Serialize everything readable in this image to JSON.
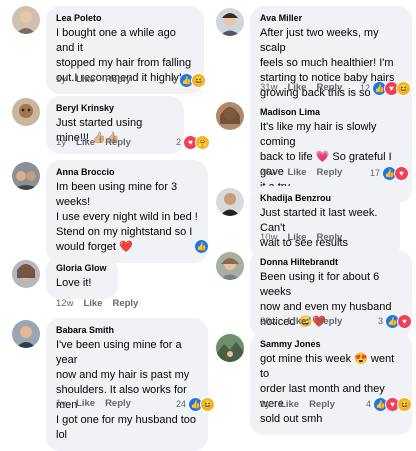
{
  "actions": {
    "like": "Like",
    "reply": "Reply"
  },
  "comments": [
    {
      "name": "Lea Poleto",
      "text": "I bought one a while ago and it\nstopped my hair from falling\nout.I recommend it highly!",
      "age": "1y",
      "reactions": "6",
      "icons": [
        "like",
        "haha"
      ]
    },
    {
      "name": "Beryl Krinsky",
      "text": "Just started using mine!!! 👍🏼👍🏼",
      "age": "1y",
      "reactions": "2",
      "icons": [
        "love",
        "care"
      ]
    },
    {
      "name": "Anna Broccio",
      "text": "Im been using mine for 3 weeks!\nI use every night wild in bed !\nStend on my nightstand so I\nwould forget ❤️",
      "age": "1y",
      "reactions": "",
      "icons": [
        "like"
      ]
    },
    {
      "name": "Gloria Glow",
      "text": "Love it!",
      "age": "12w",
      "reactions": "",
      "icons": []
    },
    {
      "name": "Babara Smith",
      "text": "I've been using mine for a year\nnow and my hair is past my\nshoulders. It also works for men\nI got one for my husband too lol",
      "age": "1y",
      "reactions": "24",
      "icons": [
        "like",
        "haha"
      ]
    },
    {
      "name": "Ava Miller",
      "text": "After just two weeks, my scalp\nfeels so much healthier! I'm\nstarting to notice baby hairs\ngrowing back this is so exciting!",
      "age": "31w",
      "reactions": "12",
      "icons": [
        "like",
        "love",
        "haha"
      ]
    },
    {
      "name": "Madison Lima",
      "text": "It's like my hair is slowly coming\nback to life 💗 So grateful I gave\nit a try.",
      "age": "26w",
      "reactions": "17",
      "icons": [
        "like",
        "love"
      ]
    },
    {
      "name": "Khadija Benzrou",
      "text": "Just started it last week. Can't\nwait to see results",
      "age": "10w",
      "reactions": "",
      "icons": []
    },
    {
      "name": "Donna Hiltebrandt",
      "text": "Been using it for about 6 weeks\nnow and even my husband\nnoticed 😅❤️",
      "age": "26w",
      "reactions": "3",
      "icons": [
        "like",
        "love"
      ]
    },
    {
      "name": "Sammy Jones",
      "text": "got mine this week 😍 went to\norder last month and they were\nsold out smh",
      "age": "1y",
      "reactions": "4",
      "icons": [
        "like",
        "love",
        "haha"
      ]
    }
  ],
  "colors": {
    "bubble": "#f0f2f5",
    "like": "#1877f2",
    "love": "#f33e58",
    "haha": "#f7b125"
  }
}
